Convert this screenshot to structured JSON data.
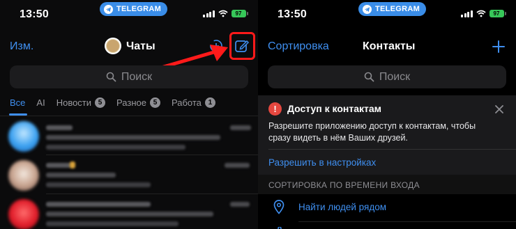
{
  "left": {
    "status": {
      "time": "13:50",
      "pill_label": "TELEGRAM",
      "battery": "97"
    },
    "nav": {
      "edit_label": "Изм.",
      "title": "Чаты"
    },
    "search": {
      "placeholder": "Поиск"
    },
    "tabs": [
      {
        "label": "Все",
        "active": true
      },
      {
        "label": "AI"
      },
      {
        "label": "Новости",
        "badge": "5"
      },
      {
        "label": "Разное",
        "badge": "5"
      },
      {
        "label": "Работа",
        "badge": "1"
      }
    ]
  },
  "right": {
    "status": {
      "time": "13:50",
      "pill_label": "TELEGRAM",
      "battery": "97"
    },
    "nav": {
      "sort_label": "Сортировка",
      "title": "Контакты",
      "add_icon": "plus-icon"
    },
    "search": {
      "placeholder": "Поиск"
    },
    "banner": {
      "title": "Доступ к контактам",
      "text": "Разрешите приложению доступ к контактам, чтобы сразу видеть в нём Ваших друзей.",
      "action": "Разрешить в настройках"
    },
    "section_header": "СОРТИРОВКА ПО ВРЕМЕНИ ВХОДА",
    "find_nearby": "Найти людей рядом"
  },
  "colors": {
    "accent": "#3f8ff0",
    "highlight": "#ff1a1a",
    "warning": "#e5473f"
  }
}
